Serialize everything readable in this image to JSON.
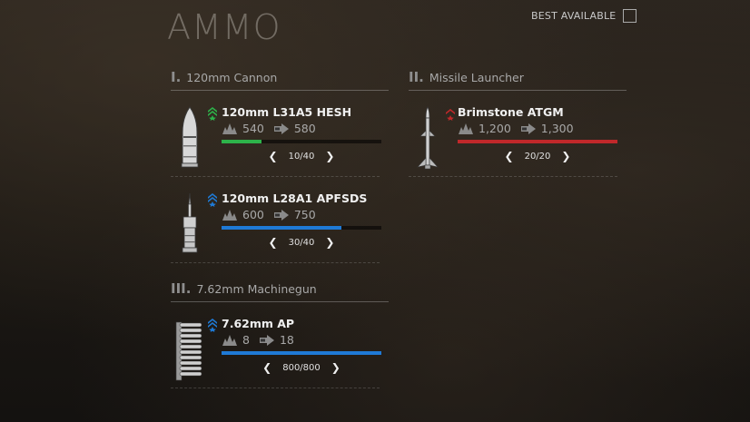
{
  "header": {
    "title": "AMMO",
    "best_available_label": "BEST AVAILABLE"
  },
  "sections": [
    {
      "numeral": "I.",
      "name": "120mm Cannon",
      "items": [
        {
          "name": "120mm L31A5 HESH",
          "damage": "540",
          "penetration": "580",
          "count": "10/40",
          "fill": 0.25,
          "color": "#2db34a",
          "rank_icon": "green-double-chevron-star-icon",
          "shell_icon": "hesh-shell-icon"
        },
        {
          "name": "120mm L28A1 APFSDS",
          "damage": "600",
          "penetration": "750",
          "count": "30/40",
          "fill": 0.75,
          "color": "#1f7ad6",
          "rank_icon": "blue-double-chevron-star-icon",
          "shell_icon": "apfsds-shell-icon"
        }
      ]
    },
    {
      "numeral": "II.",
      "name": "Missile Launcher",
      "items": [
        {
          "name": "Brimstone ATGM",
          "damage": "1,200",
          "penetration": "1,300",
          "count": "20/20",
          "fill": 1.0,
          "color": "#c0282a",
          "rank_icon": "red-chevron-star-icon",
          "shell_icon": "missile-icon"
        }
      ]
    },
    {
      "numeral": "III.",
      "name": "7.62mm Machinegun",
      "items": [
        {
          "name": "7.62mm AP",
          "damage": "8",
          "penetration": "18",
          "count": "800/800",
          "fill": 1.0,
          "color": "#1f7ad6",
          "rank_icon": "blue-double-chevron-star-icon",
          "shell_icon": "ammo-belt-icon"
        }
      ]
    }
  ]
}
